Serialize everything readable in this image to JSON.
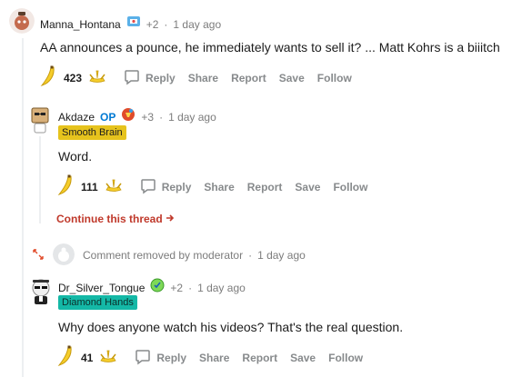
{
  "comments": [
    {
      "username": "Manna_Hontana",
      "award_count": "+2",
      "separator": "·",
      "time": "1 day ago",
      "text": "AA announces a pounce, he immediately wants to sell it? ... Matt Kohrs is a biiitch",
      "score": "423"
    },
    {
      "username": "Akdaze",
      "op_badge": "OP",
      "award_count": "+3",
      "separator": "·",
      "time": "1 day ago",
      "flair": "Smooth Brain",
      "text": "Word.",
      "score": "111"
    },
    {
      "removed_text": "Comment removed by moderator",
      "separator": "·",
      "time": "1 day ago"
    },
    {
      "username": "Dr_Silver_Tongue",
      "award_count": "+2",
      "separator": "·",
      "time": "1 day ago",
      "flair": "Diamond Hands",
      "text": "Why does anyone watch his videos? That's the real question.",
      "score": "41"
    }
  ],
  "actions": {
    "reply": "Reply",
    "share": "Share",
    "report": "Report",
    "save": "Save",
    "follow": "Follow"
  },
  "continue_thread": "Continue this thread",
  "colors": {
    "op": "#0079d3",
    "smooth_brain_flair": "#e6c31d",
    "diamond_hands_flair": "#14b8a6",
    "continue_link": "#c0392b",
    "action_gray": "#878a8c"
  }
}
